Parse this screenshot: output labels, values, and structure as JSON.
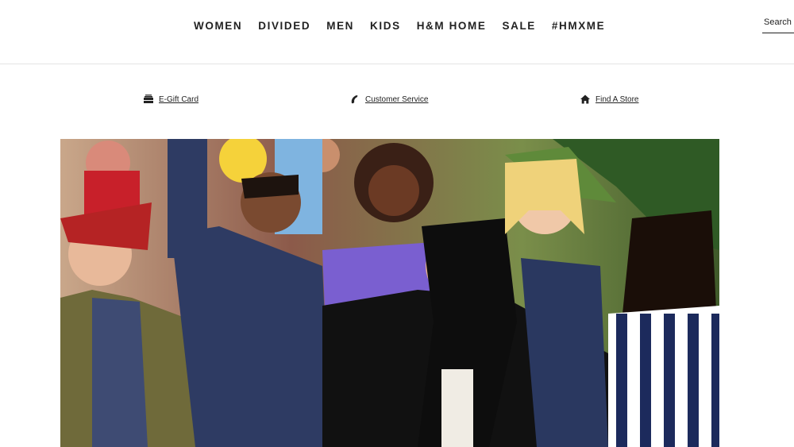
{
  "nav": {
    "items": [
      {
        "label": "WOMEN"
      },
      {
        "label": "DIVIDED"
      },
      {
        "label": "MEN"
      },
      {
        "label": "KIDS"
      },
      {
        "label": "H&M HOME"
      },
      {
        "label": "SALE"
      },
      {
        "label": "#HMXME"
      }
    ]
  },
  "search": {
    "placeholder": "Search p"
  },
  "utility": {
    "gift_card": {
      "label": "E-Gift Card",
      "icon": "gift-card-icon"
    },
    "customer_service": {
      "label": "Customer Service",
      "icon": "phone-icon"
    },
    "find_store": {
      "label": "Find A Store",
      "icon": "house-icon"
    }
  },
  "hero": {
    "description_icon": "hero-image"
  },
  "colors": {
    "text": "#222222",
    "divider": "#e4e4e4",
    "background": "#ffffff"
  }
}
